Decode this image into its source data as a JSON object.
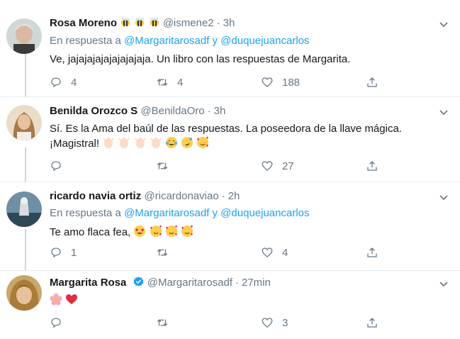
{
  "tweets": [
    {
      "name": "Rosa Moreno",
      "name_emojis": [
        "bee",
        "bee",
        "bee"
      ],
      "handle": "@ismene2",
      "time": "3h",
      "reply_prefix": "En respuesta a",
      "reply_mentions": "@Margaritarosadf y @duquejuancarlos",
      "text": "Ve, jajajajajajajajajaja. Un libro con las respuestas de Margarita.",
      "reply_count": "4",
      "retweet_count": "4",
      "like_count": "188"
    },
    {
      "name": "Benilda Orozco S",
      "handle": "@BenildaOro",
      "time": "3h",
      "text_line1": "Sí. Es la Ama del baúl de las respuestas. La poseedora de la llave mágica.",
      "text_line2": "¡Magistral!",
      "emojis": [
        "clapping-hands",
        "clapping-hands",
        "clapping-hands",
        "clapping-hands",
        "tears-of-joy",
        "rofl",
        "smiling-face-with-hearts"
      ],
      "reply_count": "",
      "retweet_count": "",
      "like_count": "27"
    },
    {
      "name": "ricardo navia ortiz",
      "handle": "@ricardonaviao",
      "time": "2h",
      "reply_prefix": "En respuesta a",
      "reply_mentions": "@Margaritarosadf y @duquejuancarlos",
      "text": "Te amo flaca fea,",
      "emojis": [
        "heart-eyes",
        "smiling-face-with-hearts",
        "smiling-face-with-hearts",
        "smiling-face-with-hearts"
      ],
      "reply_count": "1",
      "retweet_count": "",
      "like_count": "4"
    },
    {
      "name": "Margarita Rosa",
      "verified": true,
      "handle": "@Margaritarosadf",
      "time": "27min",
      "emojis": [
        "flower",
        "red-heart"
      ],
      "reply_count": "",
      "retweet_count": "",
      "like_count": "3"
    }
  ],
  "colors": {
    "accent": "#1da1f2",
    "secondary_text": "#657786",
    "divider": "#e6ecf0",
    "thread_line": "#ccd6dd"
  }
}
